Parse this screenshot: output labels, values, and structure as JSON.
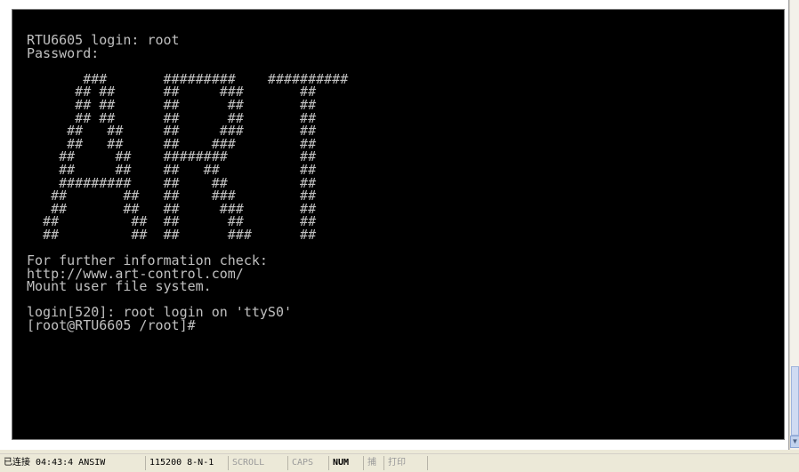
{
  "terminal": {
    "lines": [
      "RTU6605 login: root",
      "Password:",
      "",
      "       ###       #########    ##########",
      "      ## ##      ##     ###       ##",
      "      ## ##      ##      ##       ##",
      "      ## ##      ##      ##       ##",
      "     ##   ##     ##     ###       ##",
      "     ##   ##     ##    ###        ##",
      "    ##     ##    ########         ##",
      "    ##     ##    ##   ##          ##",
      "    #########    ##    ##         ##",
      "   ##       ##   ##    ###        ##",
      "   ##       ##   ##     ###       ##",
      "  ##         ##  ##      ##       ##",
      "  ##         ##  ##      ###      ##",
      "",
      "For further information check:",
      "http://www.art-control.com/",
      "Mount user file system.",
      "",
      "login[520]: root login on 'ttyS0'",
      "[root@RTU6605 /root]#"
    ]
  },
  "statusbar": {
    "connection": "已连接 04:43:4 ANSIW",
    "serial": "115200 8-N-1",
    "scroll": "SCROLL",
    "caps": "CAPS",
    "num": "NUM",
    "capture": "捕",
    "print": "打印"
  }
}
